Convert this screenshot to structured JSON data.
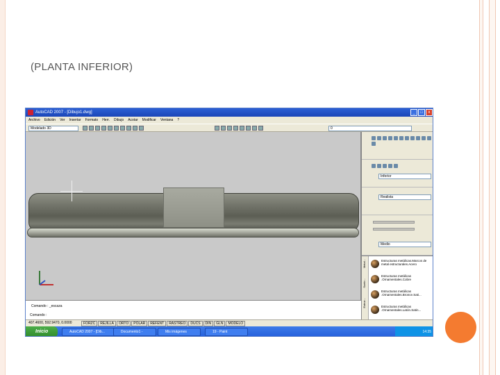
{
  "slide": {
    "title": "(PLANTA INFERIOR)"
  },
  "window": {
    "title": "AutoCAD 2007 - [Dibujo1.dwg]",
    "controls": {
      "minimize": "_",
      "restore": "□",
      "close": "x"
    }
  },
  "menu": [
    "Archivo",
    "Edición",
    "Ver",
    "Insertar",
    "Formato",
    "Herr.",
    "Dibujo",
    "Acotar",
    "Modificar",
    "Ventana",
    "?"
  ],
  "toolbar": {
    "workspace": "Modelado 3D",
    "layer": "0"
  },
  "palette": {
    "view_select": "Inferior",
    "visual_style_select": "Realista",
    "light_select": "Medio",
    "tabs": [
      "Metal...",
      "Suelo...",
      "Estruc..."
    ],
    "materials": [
      "Estructuras metálicas.Marcos de metal estructurales.Acero",
      "Estructuras metálicas .Ornamentales.Cobre",
      "Estructuras metálicas .Ornamentales.Bronce.Sati...",
      "Estructuras metálicas .Ornamentales.Latón.Satin..."
    ]
  },
  "command": {
    "line1": "Comando : _escaza",
    "line2": "Comando :"
  },
  "status": {
    "coords": "407.4600, 592.9470, 0.0000",
    "modes": [
      "FORZC",
      "REJILLA",
      "ORTO",
      "POLAR",
      "REFENT",
      "RASTREO",
      "DUCS",
      "DIN",
      "GLN",
      "MODELO"
    ]
  },
  "taskbar": {
    "start": "Inicio",
    "tasks": [
      "AutoCAD 2007 - [Dib...",
      "Documento1 - Micros...",
      "Mis imágenes",
      "19 - Paint"
    ],
    "clock": "14:35"
  },
  "colors": {
    "accent_circle": "#f47b30",
    "titlebar": "#245edb"
  }
}
